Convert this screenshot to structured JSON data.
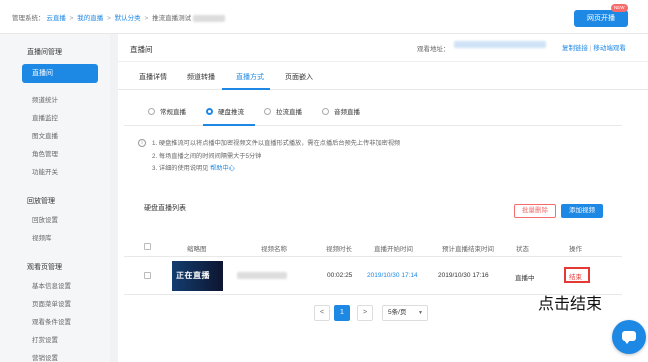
{
  "breadcrumb": {
    "prefix": "管理系统：",
    "items": [
      "云直播",
      "我的直播",
      "默认分类",
      "推流直播测试"
    ],
    "separator": ">"
  },
  "header": {
    "live_button": "网页开播",
    "new_badge": "NEW"
  },
  "sidebar": {
    "group1": "直播间管理",
    "active_item": "直播间",
    "items1": [
      "频道统计",
      "直播监控",
      "图文直播",
      "角色管理",
      "功能开关"
    ],
    "group2": "回放管理",
    "items2": [
      "回放设置",
      "视频库"
    ],
    "group3": "观看页管理",
    "items3": [
      "基本信息设置",
      "页面菜单设置",
      "观看条件设置",
      "打赏设置",
      "营销设置"
    ]
  },
  "page": {
    "title": "直播间",
    "watch_label": "观看地址：",
    "copy_link": "复制链接",
    "mobile_watch": "移动端观看"
  },
  "tabs": [
    "直播详情",
    "频道转播",
    "直播方式",
    "页面嵌入"
  ],
  "active_tab": "直播方式",
  "modes": [
    "常规直播",
    "硬盘推流",
    "拉流直播",
    "音频直播"
  ],
  "selected_mode": "硬盘推流",
  "tips": {
    "line1": "1. 硬盘推流可以将点播中加密视频文件以直播形式播放，需在点播后台预先上传非加密视频",
    "line2": "2. 每场直播之间的时间间隔需大于5分钟",
    "line3_prefix": "3. 详细的使用说明见",
    "help_link": "帮助中心"
  },
  "list": {
    "title": "硬盘直播列表",
    "batch_delete": "批量删除",
    "add_video": "添加视频",
    "columns": [
      "缩略图",
      "视频名称",
      "视频时长",
      "直播开始时间",
      "预计直播结束时间",
      "状态",
      "操作"
    ],
    "rows": [
      {
        "thumb_text": "正在直播",
        "duration": "00:02:25",
        "start_time": "2019/10/30 17:14",
        "end_time": "2019/10/30 17:16",
        "status": "直播中",
        "action": "结束"
      }
    ]
  },
  "pagination": {
    "prev": "<",
    "current_page": "1",
    "next": ">",
    "page_size": "5条/页"
  },
  "annotation": "点击结束",
  "colors": {
    "accent": "#1e88e5",
    "danger": "#e53935"
  }
}
